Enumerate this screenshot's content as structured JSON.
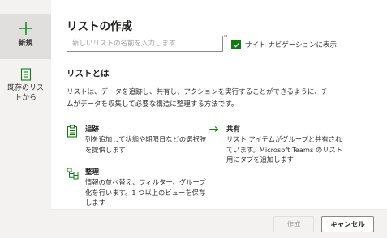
{
  "sidebar": {
    "items": [
      {
        "label": "新規",
        "icon": "plus-icon",
        "selected": true
      },
      {
        "label": "既存のリストから",
        "icon": "document-list-icon",
        "selected": false
      }
    ]
  },
  "main": {
    "title": "リストの作成",
    "name_input": {
      "placeholder": "新しいリストの名前を入力します",
      "value": ""
    },
    "required_marker": "*",
    "nav_checkbox": {
      "label": "サイト ナビゲーションに表示",
      "checked": true
    }
  },
  "about": {
    "title": "リストとは",
    "description": "リストは、データを追跡し、共有し、アクションを実行することができるように、チームがデータを収集して必要な構造に整理する方法です。"
  },
  "features": [
    {
      "title": "追跡",
      "description": "列を追加して状態や期限日などの選択肢を提供します",
      "icon": "clipboard-list-icon"
    },
    {
      "title": "共有",
      "description": "リスト アイテムがグループと共有されています。Microsoft Teams のリスト用にタブを追加します",
      "icon": "share-icon"
    },
    {
      "title": "整理",
      "description": "情報の並べ替え、フィルター、グループ化を行います。1 つ以上のビューを保存します",
      "icon": "organize-icon"
    }
  ],
  "footer": {
    "create_label": "作成",
    "cancel_label": "キャンセル"
  },
  "colors": {
    "accent": "#107c10",
    "sidebar_bg": "#f3f2f1",
    "selected_bg": "#e1dfdd"
  }
}
